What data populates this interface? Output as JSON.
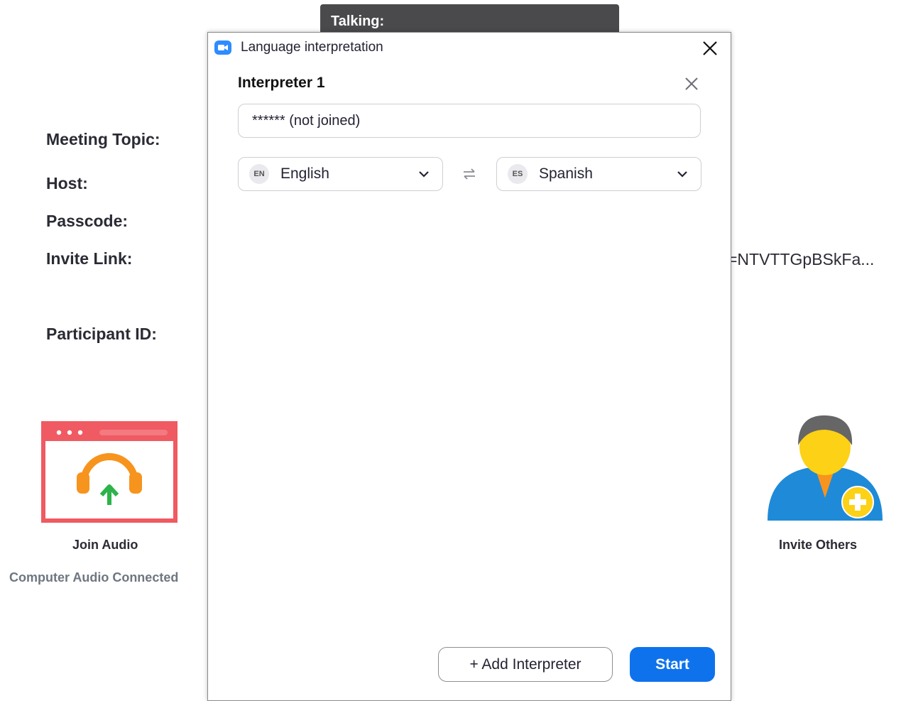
{
  "background": {
    "talking_label": "Talking:",
    "meeting_info_labels": {
      "topic": "Meeting Topic:",
      "host": "Host:",
      "passcode": "Passcode:",
      "invite_link": "Invite Link:",
      "participant_id": "Participant ID:"
    },
    "invite_link_value": "=NTVTTGpBSkFa...",
    "join_audio": {
      "label": "Join Audio",
      "status": "Computer Audio Connected",
      "icon": "headphones-icon"
    },
    "invite_others": {
      "label": "Invite Others",
      "icon": "add-person-icon"
    }
  },
  "dialog": {
    "title": "Language interpretation",
    "icon": "zoom-camera-icon",
    "interpreter": {
      "heading": "Interpreter 1",
      "name_value": "****** (not joined)",
      "source_language": {
        "code": "EN",
        "name": "English"
      },
      "target_language": {
        "code": "ES",
        "name": "Spanish"
      }
    },
    "buttons": {
      "add_interpreter": "+ Add Interpreter",
      "start": "Start"
    },
    "colors": {
      "accent": "#0e72ed",
      "brand_icon": "#2d8cff"
    }
  }
}
